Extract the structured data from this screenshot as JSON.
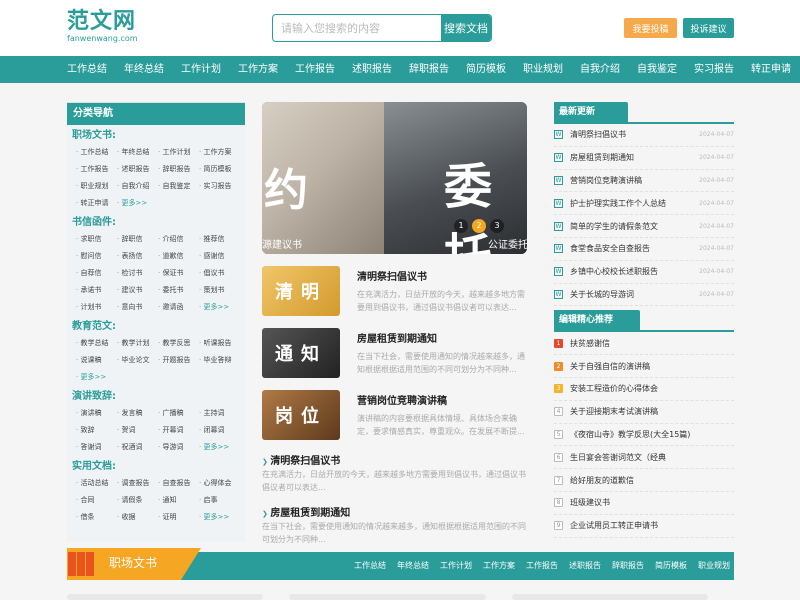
{
  "header": {
    "logo_cn": "范文网",
    "logo_en": "fanwenwang.com",
    "search_placeholder": "请输入您搜索的内容",
    "search_button": "搜索文档",
    "submit_button": "我要投稿",
    "complain_button": "投诉建议"
  },
  "nav": [
    "工作总结",
    "年终总结",
    "工作计划",
    "工作方案",
    "工作报告",
    "述职报告",
    "辞职报告",
    "简历模板",
    "职业规划",
    "自我介绍",
    "自我鉴定",
    "实习报告",
    "转正申请"
  ],
  "sidebar": {
    "title": "分类导航",
    "categories": [
      {
        "title": "职场文书:",
        "items": [
          "工作总结",
          "年终总结",
          "工作计划",
          "工作方案",
          "工作报告",
          "述职报告",
          "辞职报告",
          "简历模板",
          "职业规划",
          "自我介绍",
          "自我鉴定",
          "实习报告",
          "转正申请"
        ],
        "more": "更多>>"
      },
      {
        "title": "书信函件:",
        "items": [
          "求职信",
          "辞职信",
          "介绍信",
          "推荐信",
          "慰问信",
          "表扬信",
          "道歉信",
          "感谢信",
          "自荐信",
          "检讨书",
          "保证书",
          "倡议书",
          "承诺书",
          "建议书",
          "委托书",
          "策划书",
          "计划书",
          "意向书",
          "邀请函"
        ],
        "more": "更多>>"
      },
      {
        "title": "教育范文:",
        "items": [
          "教学总结",
          "教学计划",
          "教学反思",
          "听课报告",
          "说课稿",
          "毕业论文",
          "开题报告",
          "毕业答辩"
        ],
        "more": "更多>>"
      },
      {
        "title": "演讲致辞:",
        "items": [
          "演讲稿",
          "发言稿",
          "广播稿",
          "主持词",
          "致辞",
          "贺词",
          "开幕词",
          "闭幕词",
          "答谢词",
          "祝酒词",
          "导游词"
        ],
        "more": "更多>>"
      },
      {
        "title": "实用文档:",
        "items": [
          "活动总结",
          "调查报告",
          "自查报告",
          "心得体会",
          "合同",
          "请假条",
          "通知",
          "启事",
          "借条",
          "收据",
          "证明"
        ],
        "more": "更多>>"
      }
    ]
  },
  "banner": {
    "glyph_a": "约",
    "glyph_b": "委托",
    "caption_a": "源建议书",
    "caption_b": "公证委托书",
    "dots": [
      "1",
      "2",
      "3"
    ],
    "active_dot": 2
  },
  "articles": [
    {
      "thumb_text": "清明",
      "title": "清明祭扫倡议书",
      "desc": "在充满活力，日益开放的今天，越来越多地方需要用到倡议书，通过倡议书倡议者可以表达..."
    },
    {
      "thumb_text": "通知",
      "title": "房屋租赁到期通知",
      "desc": "在当下社会，需要使用通知的情况越来越多，通知根据根据适用范围的不同可划分为不同种..."
    },
    {
      "thumb_text": "岗位",
      "title": "营销岗位竞聘演讲稿",
      "desc": "演讲稿的内容要根据具体情境、具体场合来确定，要求情感真实，尊重观众。在发展不断提..."
    }
  ],
  "wide_articles": [
    {
      "title": "清明祭扫倡议书",
      "desc": "在充满活力，日益开放的今天，越来越多地方需要用到倡议书，通过倡议书倡议者可以表达..."
    },
    {
      "title": "房屋租赁到期通知",
      "desc": "在当下社会，需要使用通知的情况越来越多，通知根据根据适用范围的不同可划分为不同种..."
    }
  ],
  "latest": {
    "title": "最新更新",
    "icon_text": "W",
    "items": [
      {
        "title": "清明祭扫倡议书",
        "date": "2024-04-07"
      },
      {
        "title": "房屋租赁到期通知",
        "date": "2024-04-07"
      },
      {
        "title": "营销岗位竞聘演讲稿",
        "date": "2024-04-07"
      },
      {
        "title": "护士护理实践工作个人总结",
        "date": "2024-04-07"
      },
      {
        "title": "简单的学生的请假条范文",
        "date": "2024-04-07"
      },
      {
        "title": "食堂食品安全自查报告",
        "date": "2024-04-07"
      },
      {
        "title": "乡镇中心校校长述职报告",
        "date": "2024-04-07"
      },
      {
        "title": "关于长城的导游词",
        "date": "2024-04-07"
      }
    ]
  },
  "recommend": {
    "title": "编辑精心推荐",
    "items": [
      {
        "num": "1",
        "title": "扶贫感谢信"
      },
      {
        "num": "2",
        "title": "关于自强自信的演讲稿"
      },
      {
        "num": "3",
        "title": "安装工程造价的心得体会"
      },
      {
        "num": "4",
        "title": "关于迎接期末考试演讲稿"
      },
      {
        "num": "5",
        "title": "《夜宿山寺》教学反思(大全15篇)"
      },
      {
        "num": "6",
        "title": "生日宴会答谢词范文（经典"
      },
      {
        "num": "7",
        "title": "给好朋友的道歉信"
      },
      {
        "num": "8",
        "title": "班级建议书"
      },
      {
        "num": "9",
        "title": "企业试用员工转正申请书"
      }
    ]
  },
  "section": {
    "title": "职场文书",
    "links": [
      "工作总结",
      "年终总结",
      "工作计划",
      "工作方案",
      "工作报告",
      "述职报告",
      "辞职报告",
      "简历模板",
      "职业规划"
    ]
  }
}
